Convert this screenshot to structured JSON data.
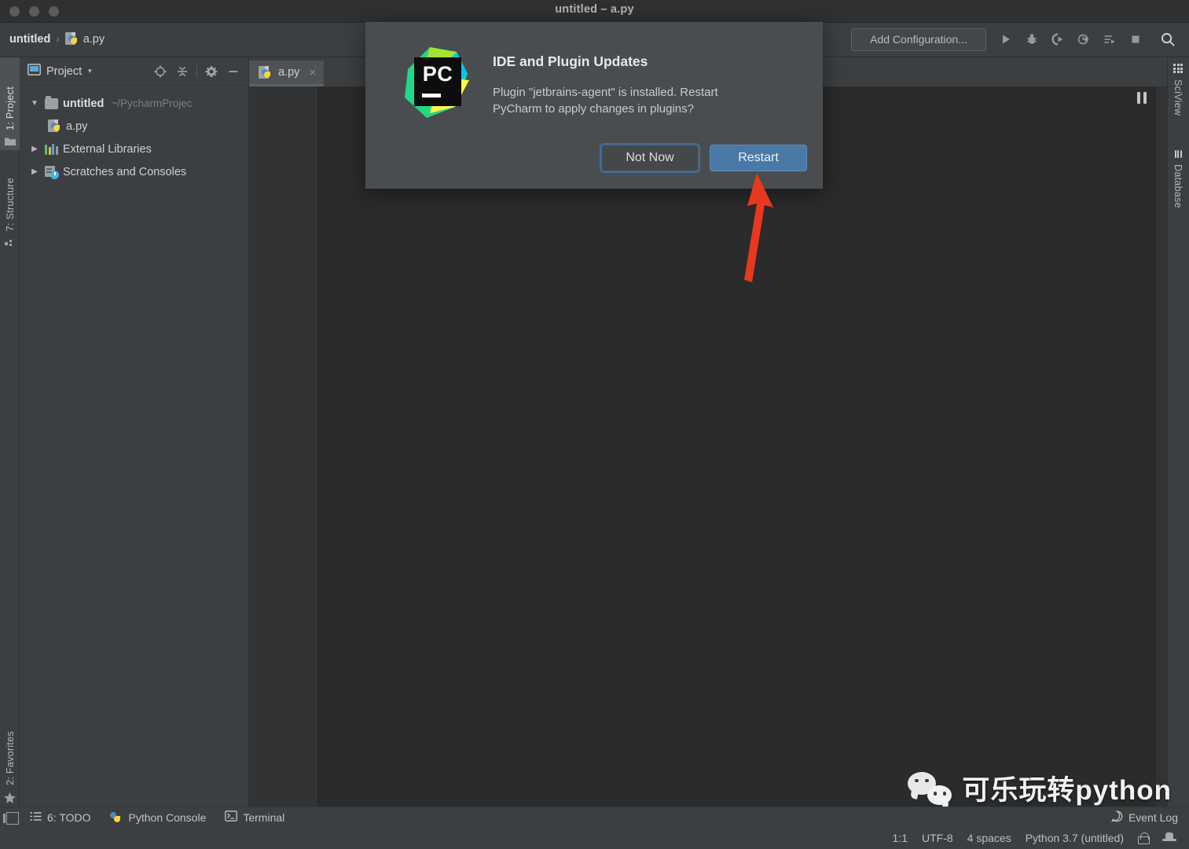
{
  "window": {
    "title": "untitled – a.py",
    "traffic_lights": [
      "close",
      "minimize",
      "zoom"
    ]
  },
  "navbar": {
    "breadcrumb": {
      "project": "untitled",
      "separator": "›",
      "file": "a.py"
    },
    "run_config": {
      "label": "Add Configuration..."
    },
    "toolbar_icons": [
      "run-icon",
      "debug-icon",
      "run-with-coverage-icon",
      "profile-icon",
      "run-tests-icon",
      "stop-icon",
      "search-everywhere-icon"
    ]
  },
  "left_tool_strip": {
    "tabs": [
      {
        "label": "1: Project",
        "icon": "folder-icon",
        "active": true
      },
      {
        "label": "7: Structure",
        "icon": "structure-icon",
        "active": false
      },
      {
        "label": "2: Favorites",
        "icon": "star-icon",
        "active": false
      }
    ]
  },
  "project_panel": {
    "title": "Project",
    "caret": "▾",
    "header_icons": [
      "locate-target-icon",
      "collapse-all-icon",
      "gear-icon",
      "minimize-icon"
    ],
    "tree": [
      {
        "label": "untitled",
        "path": "~/PycharmProjec",
        "icon": "folder-icon",
        "twisty": "▼",
        "level": 1,
        "bold": true
      },
      {
        "label": "a.py",
        "icon": "python-file-icon",
        "twisty": "",
        "level": 2,
        "bold": false,
        "path": ""
      },
      {
        "label": "External Libraries",
        "icon": "libraries-icon",
        "twisty": "▶",
        "level": 1,
        "bold": false,
        "path": ""
      },
      {
        "label": "Scratches and Consoles",
        "icon": "scratches-icon",
        "twisty": "▶",
        "level": 1,
        "bold": false,
        "path": ""
      }
    ]
  },
  "editor": {
    "tabs": [
      {
        "label": "a.py",
        "icon": "python-file-icon",
        "close": "×",
        "active": true
      }
    ],
    "content": "",
    "pause_icon": "pause-icon"
  },
  "right_tool_strip": {
    "tabs": [
      {
        "label": "SciView",
        "icon": "grid-icon"
      },
      {
        "label": "Database",
        "icon": "database-icon"
      }
    ]
  },
  "bottom_tool_strip": {
    "tabs": [
      {
        "label": "6: TODO",
        "accel": "6",
        "icon": "todo-list-icon"
      },
      {
        "label": "Python Console",
        "icon": "python-console-icon"
      },
      {
        "label": "Terminal",
        "icon": "terminal-icon"
      }
    ],
    "event_log": {
      "label": "Event Log",
      "icon": "event-log-icon"
    },
    "corner_icon": "show-tool-windows-icon"
  },
  "status_bar": {
    "caret_position": "1:1",
    "encoding": "UTF-8",
    "indent": "4 spaces",
    "interpreter": "Python 3.7 (untitled)",
    "icons": [
      "lock-icon",
      "inspection-hat-icon"
    ]
  },
  "dialog": {
    "title": "IDE and Plugin Updates",
    "message": "Plugin \"jetbrains-agent\" is installed. Restart PyCharm to apply changes in plugins?",
    "logo": {
      "name": "pycharm-logo",
      "text": "PC"
    },
    "buttons": [
      {
        "label": "Not Now",
        "style": "secondary"
      },
      {
        "label": "Restart",
        "style": "primary"
      }
    ]
  },
  "annotation": {
    "arrow": {
      "name": "red-arrow-pointing-to-restart",
      "color": "#e8381f"
    }
  },
  "watermark": {
    "text": "可乐玩转python",
    "icon": "wechat-icon"
  },
  "colors": {
    "accent_blue": "#4a79a8",
    "panel_bg": "#3c3f41",
    "editor_bg": "#2b2b2b",
    "arrow_red": "#e8381f"
  }
}
